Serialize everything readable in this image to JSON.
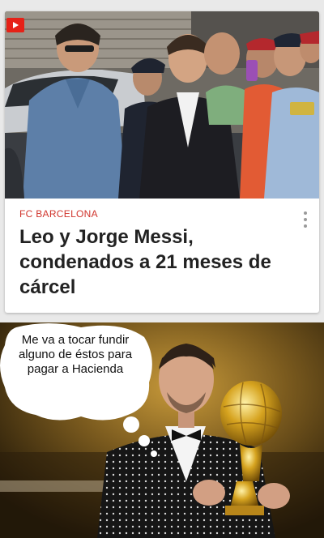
{
  "article": {
    "section": "FC BARCELONA",
    "headline": "Leo y Jorge Messi, condenados a 21 meses de cárcel",
    "video_badge_icon": "play-icon",
    "menu_icon": "more-vert-icon"
  },
  "meme": {
    "bubble_text": "Me va a tocar fundir alguno de éstos para pagar a Hacienda"
  },
  "colors": {
    "section": "#d0342c",
    "headline": "#222222",
    "badge": "#e62117"
  }
}
